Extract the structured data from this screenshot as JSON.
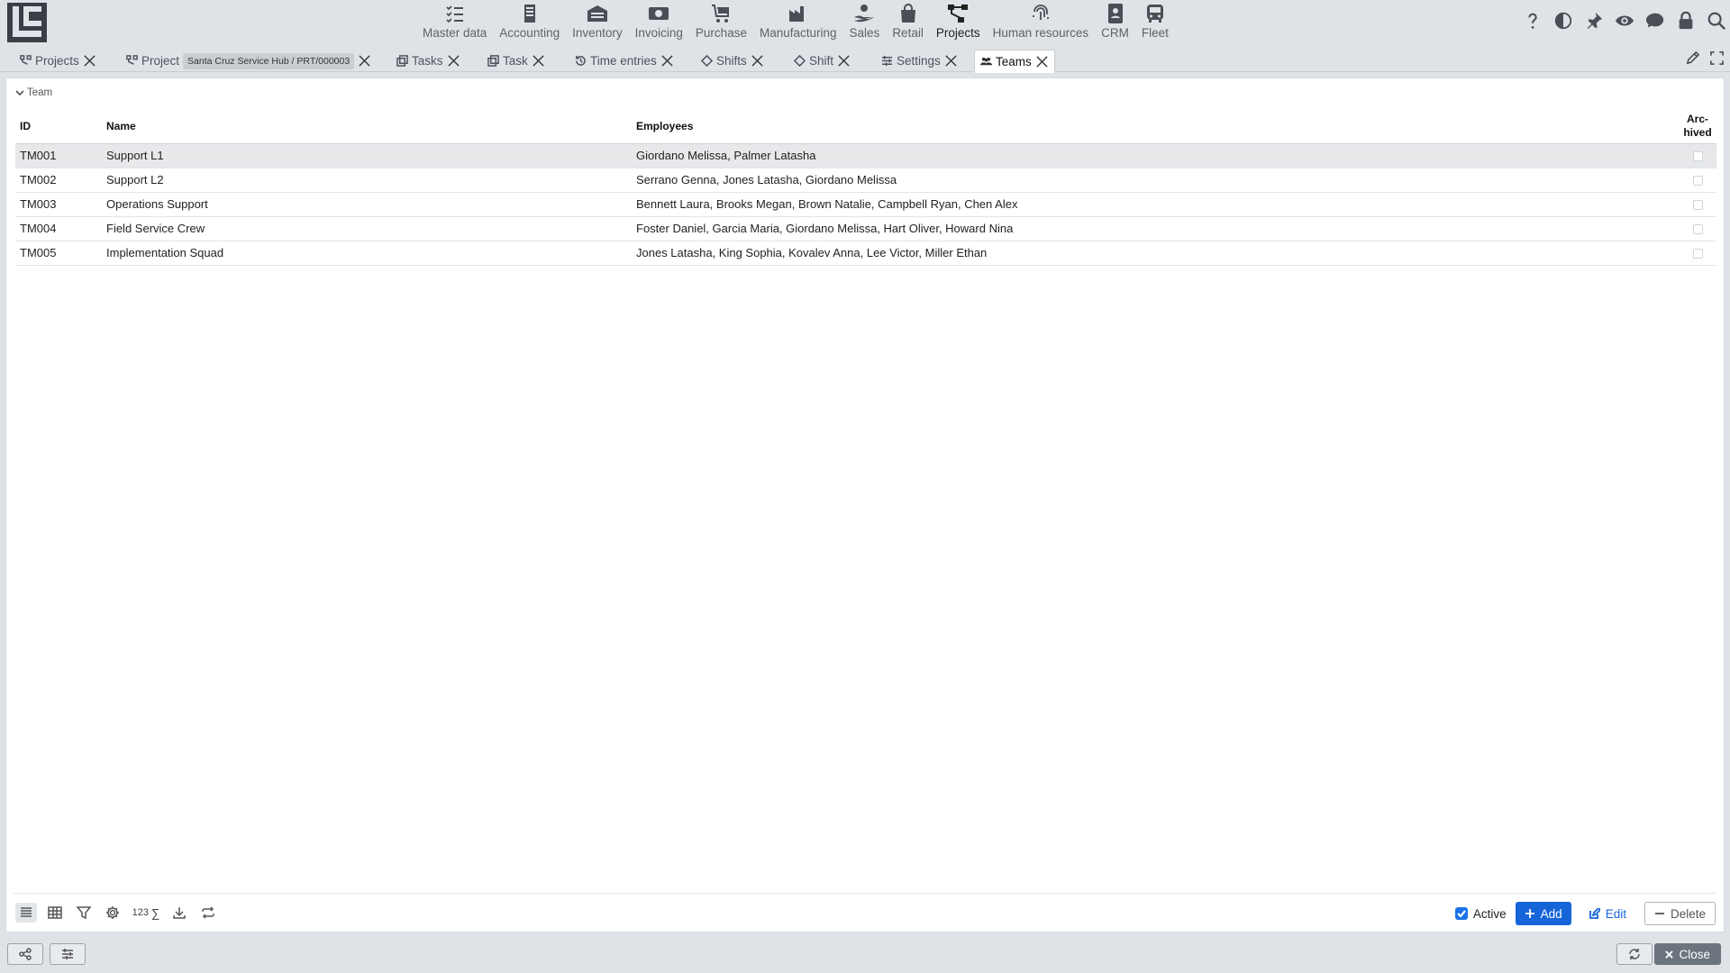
{
  "nav": {
    "items": [
      {
        "label": "Master data",
        "icon": "checklist-icon"
      },
      {
        "label": "Accounting",
        "icon": "ledger-icon"
      },
      {
        "label": "Inventory",
        "icon": "warehouse-icon"
      },
      {
        "label": "Invoicing",
        "icon": "cash-icon"
      },
      {
        "label": "Purchase",
        "icon": "cart-icon"
      },
      {
        "label": "Manufacturing",
        "icon": "factory-icon"
      },
      {
        "label": "Sales",
        "icon": "hand-money-icon"
      },
      {
        "label": "Retail",
        "icon": "shopping-bag-icon"
      },
      {
        "label": "Projects",
        "icon": "diagram-icon"
      },
      {
        "label": "Human resources",
        "icon": "fingerprint-icon"
      },
      {
        "label": "CRM",
        "icon": "contact-icon"
      },
      {
        "label": "Fleet",
        "icon": "bus-icon"
      }
    ],
    "active": "Projects"
  },
  "tabs": [
    {
      "label": "Projects",
      "icon": "diagram-icon"
    },
    {
      "label": "Project",
      "icon": "diagram-icon",
      "pill": "Santa Cruz Service Hub / PRT/000003"
    },
    {
      "label": "Tasks",
      "icon": "copy-icon"
    },
    {
      "label": "Task",
      "icon": "copy-icon"
    },
    {
      "label": "Time entries",
      "icon": "history-icon"
    },
    {
      "label": "Shifts",
      "icon": "diamond-icon"
    },
    {
      "label": "Shift",
      "icon": "diamond-icon"
    },
    {
      "label": "Settings",
      "icon": "sliders-icon"
    },
    {
      "label": "Teams",
      "icon": "people-icon"
    }
  ],
  "section": {
    "label": "Team"
  },
  "table": {
    "headers": {
      "id": "ID",
      "name": "Name",
      "employees": "Employees",
      "archived_1": "Arc-",
      "archived_2": "hived"
    },
    "rows": [
      {
        "id": "TM001",
        "name": "Support L1",
        "employees": "Giordano Melissa, Palmer Latasha",
        "archived": false
      },
      {
        "id": "TM002",
        "name": "Support L2",
        "employees": "Serrano Genna, Jones Latasha, Giordano Melissa",
        "archived": false
      },
      {
        "id": "TM003",
        "name": "Operations Support",
        "employees": "Bennett Laura, Brooks Megan, Brown Natalie, Campbell Ryan, Chen Alex",
        "archived": false
      },
      {
        "id": "TM004",
        "name": "Field Service Crew",
        "employees": "Foster Daniel, Garcia Maria, Giordano Melissa, Hart Oliver, Howard Nina",
        "archived": false
      },
      {
        "id": "TM005",
        "name": "Implementation Squad",
        "employees": "Jones Latasha, King Sophia, Kovalev Anna, Lee Victor, Miller Ethan",
        "archived": false
      }
    ]
  },
  "toolbar": {
    "count_label": "123",
    "sum_label": "∑"
  },
  "actions": {
    "active_label": "Active",
    "add_label": "Add",
    "edit_label": "Edit",
    "delete_label": "Delete"
  },
  "footer": {
    "close_label": "Close"
  }
}
